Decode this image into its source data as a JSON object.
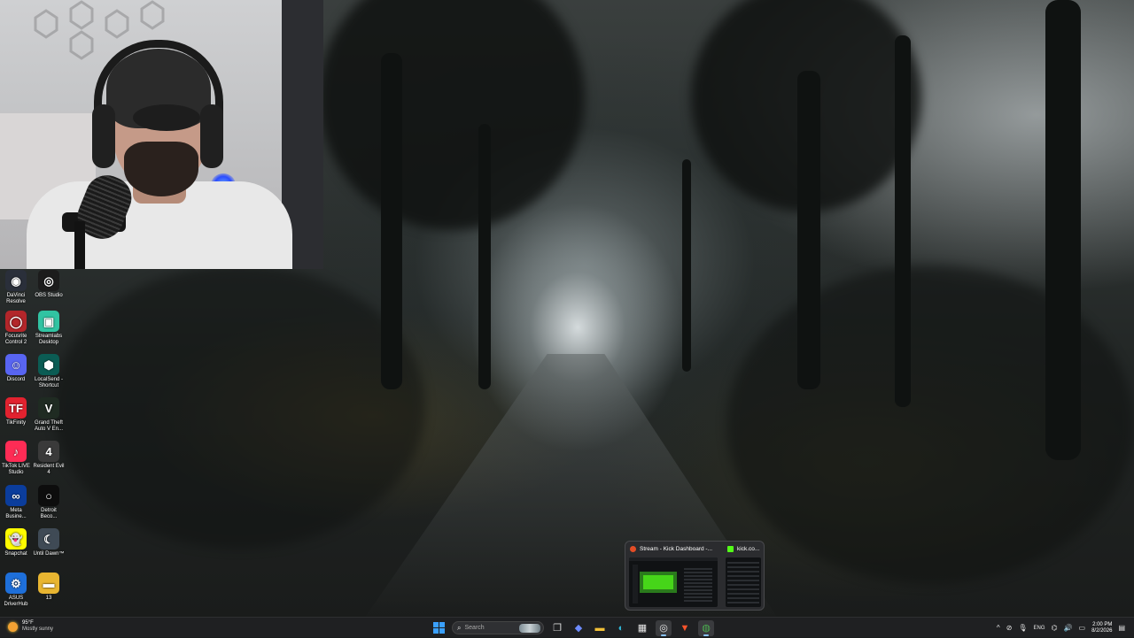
{
  "desktop": {
    "icons": [
      {
        "label": "DaVinci Resolve",
        "icon": "davinci-resolve-icon",
        "bg": "#2a2f3a",
        "glyph": "◉"
      },
      {
        "label": "OBS Studio",
        "icon": "obs-studio-icon",
        "bg": "#1c1c1c",
        "glyph": "◎"
      },
      {
        "label": "Focusrite Control 2",
        "icon": "focusrite-control-icon",
        "bg": "#b3262a",
        "glyph": "◯"
      },
      {
        "label": "Streamlabs Desktop",
        "icon": "streamlabs-icon",
        "bg": "#31c3a2",
        "glyph": "▣"
      },
      {
        "label": "Discord",
        "icon": "discord-icon",
        "bg": "#5865f2",
        "glyph": "☺"
      },
      {
        "label": "LocalSend - Shortcut",
        "icon": "localsend-icon",
        "bg": "#0b5c54",
        "glyph": "⬢"
      },
      {
        "label": "TikFinity",
        "icon": "tikfinity-icon",
        "bg": "#e2222f",
        "glyph": "TF"
      },
      {
        "label": "Grand Theft Auto V En...",
        "icon": "gta-v-icon",
        "bg": "#1f2b22",
        "glyph": "V"
      },
      {
        "label": "TikTok LIVE Studio",
        "icon": "tiktok-live-studio-icon",
        "bg": "#fe2c55",
        "glyph": "♪"
      },
      {
        "label": "Resident Evil 4",
        "icon": "resident-evil-4-icon",
        "bg": "#3a3a3a",
        "glyph": "4"
      },
      {
        "label": "Meta Busine...",
        "icon": "meta-business-icon",
        "bg": "#0b3d9c",
        "glyph": "∞"
      },
      {
        "label": "Detroit Beco...",
        "icon": "detroit-become-human-icon",
        "bg": "#0d0d0d",
        "glyph": "○"
      },
      {
        "label": "Snapchat",
        "icon": "snapchat-icon",
        "bg": "#fffc00",
        "glyph": "👻"
      },
      {
        "label": "Until Dawn™",
        "icon": "until-dawn-icon",
        "bg": "#3f4a55",
        "glyph": "☾"
      },
      {
        "label": "ASUS DriverHub",
        "icon": "asus-driverhub-icon",
        "bg": "#1e6fd9",
        "glyph": "⚙"
      },
      {
        "label": "13",
        "icon": "folder-icon",
        "bg": "#e8b531",
        "glyph": "▬"
      }
    ]
  },
  "taskbar": {
    "weather": {
      "temp": "95°F",
      "condition": "Mostly sunny"
    },
    "search_placeholder": "Search",
    "apps": [
      {
        "name": "start-button",
        "icon": "windows-icon"
      },
      {
        "name": "task-view-button",
        "icon": "task-view-icon",
        "glyph": "❐",
        "color": "#d8d8d8"
      },
      {
        "name": "copilot-button",
        "icon": "copilot-icon",
        "glyph": "◆",
        "color": "#6d8bff"
      },
      {
        "name": "file-explorer-button",
        "icon": "folder-icon",
        "glyph": "▬",
        "color": "#f2c038"
      },
      {
        "name": "edge-button",
        "icon": "edge-icon",
        "glyph": "◐",
        "color": "#2fb7d8"
      },
      {
        "name": "store-button",
        "icon": "store-icon",
        "glyph": "▦",
        "color": "#e8e8e8"
      },
      {
        "name": "obs-button",
        "icon": "obs-studio-icon",
        "glyph": "◎",
        "color": "#e6e6e6",
        "active": true
      },
      {
        "name": "brave-button",
        "icon": "brave-icon",
        "glyph": "▼",
        "color": "#fb542b"
      },
      {
        "name": "chrome-button",
        "icon": "chrome-icon",
        "glyph": "◍",
        "color": "#4caf50",
        "active": true
      }
    ],
    "tray": {
      "chevron": "^",
      "language": "ENG",
      "time": "2:00 PM",
      "date": "8/2/2026"
    }
  },
  "chrome_preview": {
    "windows": [
      {
        "title": "Stream - Kick Dashboard -...",
        "favicon_color": "#e44d26"
      },
      {
        "title": "kick.co...",
        "favicon_color": "#53fc18"
      }
    ]
  }
}
